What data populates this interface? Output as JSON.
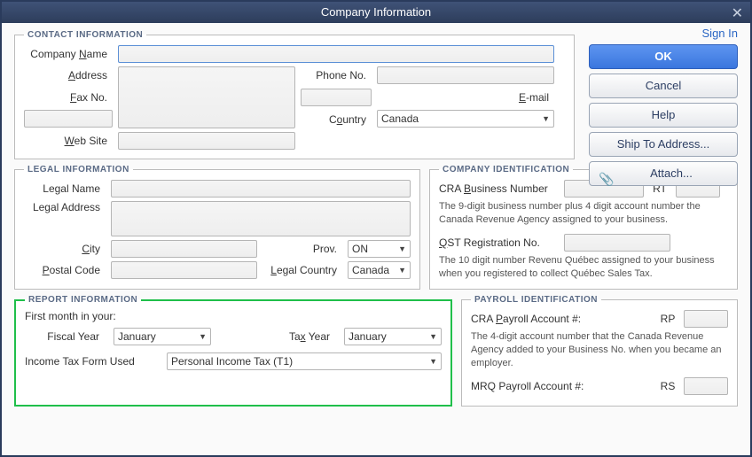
{
  "window": {
    "title": "Company Information"
  },
  "actions": {
    "signin": "Sign In",
    "ok": "OK",
    "cancel": "Cancel",
    "help": "Help",
    "shipto": "Ship To Address...",
    "attach": "Attach..."
  },
  "contact": {
    "legend": "CONTACT INFORMATION",
    "company_name_label_pre": "Company ",
    "company_name_label_u": "N",
    "company_name_label_post": "ame",
    "company_name": "",
    "address_label_pre": "",
    "address_label_u": "A",
    "address_label_post": "ddress",
    "address": "",
    "country_label_pre": "C",
    "country_label_u": "o",
    "country_label_post": "untry",
    "country": "Canada",
    "phone_label": "Phone No.",
    "phone": "",
    "fax_label_pre": "",
    "fax_label_u": "F",
    "fax_label_post": "ax No.",
    "fax": "",
    "email_label_pre": "",
    "email_label_u": "E",
    "email_label_post": "-mail",
    "email": "",
    "web_label_pre": "",
    "web_label_u": "W",
    "web_label_post": "eb Site",
    "web": ""
  },
  "legal": {
    "legend": "LEGAL INFORMATION",
    "name_label": "Legal Name",
    "name": "",
    "address_label": "Legal Address",
    "address": "",
    "city_label_pre": "",
    "city_label_u": "C",
    "city_label_post": "ity",
    "city": "",
    "prov_label": "Prov.",
    "prov": "ON",
    "postal_label_pre": "",
    "postal_label_u": "P",
    "postal_label_post": "ostal Code",
    "postal": "",
    "country_label_pre": "",
    "country_label_u": "L",
    "country_label_post": "egal Country",
    "country": "Canada"
  },
  "report": {
    "legend": "REPORT INFORMATION",
    "first_month": "First month in your:",
    "fiscal_label": "Fiscal Year",
    "fiscal": "January",
    "tax_year_label_pre": "Ta",
    "tax_year_label_u": "x",
    "tax_year_label_post": " Year",
    "tax_year": "January",
    "tax_form_label": "Income Tax Form Used",
    "tax_form": "Personal Income Tax (T1)"
  },
  "company_id": {
    "legend": "COMPANY IDENTIFICATION",
    "cra_label_pre": "CRA ",
    "cra_label_u": "B",
    "cra_label_post": "usiness Number",
    "cra_value": "",
    "cra_suffix": "RT",
    "cra_value2": "",
    "cra_info": "The 9-digit business number plus 4 digit account number the Canada Revenue Agency assigned to your business.",
    "qst_label_pre": "",
    "qst_label_u": "Q",
    "qst_label_post": "ST Registration No.",
    "qst_value": "",
    "qst_info": "The 10 digit number Revenu Québec assigned to your business when you registered to collect Québec Sales Tax."
  },
  "payroll": {
    "legend": "PAYROLL IDENTIFICATION",
    "cra_label_pre": "CRA ",
    "cra_label_u": "P",
    "cra_label_post": "ayroll Account #:",
    "cra_suffix": "RP",
    "cra_value": "",
    "cra_info": "The 4-digit account number that the Canada Revenue Agency added to your Business No. when you became an employer.",
    "mrq_label": "MRQ Payroll Account #:",
    "mrq_suffix": "RS",
    "mrq_value": ""
  }
}
